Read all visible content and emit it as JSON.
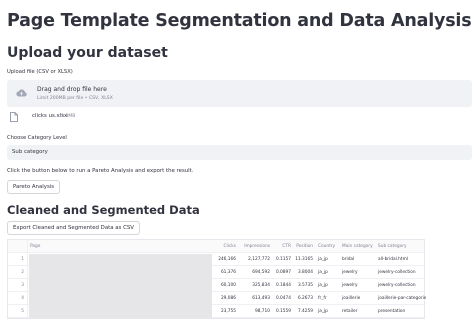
{
  "page": {
    "title": "Page Template Segmentation and Data Analysis"
  },
  "upload": {
    "heading": "Upload your dataset",
    "label": "Upload file (CSV or XLSX)",
    "drop_title": "Drag and drop file here",
    "drop_sub": "Limit 200MB per file • CSV, XLSX",
    "file_name": "clicks us.xlsx",
    "file_size": "1.8MB"
  },
  "category": {
    "label": "Choose Category Level",
    "selected": "Sub category"
  },
  "pareto": {
    "instruction": "Click the button below to run a Pareto Analysis and export the result.",
    "button_label": "Pareto Analysis"
  },
  "cleaned": {
    "heading": "Cleaned and Segmented Data",
    "export_label": "Export Cleaned and Segmented Data as CSV"
  },
  "table": {
    "columns": [
      "Page",
      "Clicks",
      "Impressions",
      "CTR",
      "Position",
      "Country",
      "Main category",
      "Sub category"
    ],
    "rows": [
      {
        "index": "1",
        "clicks": "246,166",
        "impressions": "2,127,772",
        "ctr": "0.1157",
        "position": "11.3165",
        "country": "ja_jp",
        "main": "bridal",
        "sub": "all-bridal.html"
      },
      {
        "index": "2",
        "clicks": "61,376",
        "impressions": "694,592",
        "ctr": "0.0897",
        "position": "3.8004",
        "country": "ja_jp",
        "main": "jewelry",
        "sub": "jewelry-collection"
      },
      {
        "index": "3",
        "clicks": "60,100",
        "impressions": "325,834",
        "ctr": "0.1844",
        "position": "3.5735",
        "country": "ja_jp",
        "main": "jewelry",
        "sub": "jewelry-collection"
      },
      {
        "index": "4",
        "clicks": "29,086",
        "impressions": "613,493",
        "ctr": "0.0474",
        "position": "6.2673",
        "country": "fr_fr",
        "main": "joaillerie",
        "sub": "joaillerie-par-categorie"
      },
      {
        "index": "5",
        "clicks": "23,755",
        "impressions": "98,710",
        "ctr": "0.1559",
        "position": "7.4259",
        "country": "ja_jp",
        "main": "retailer",
        "sub": "presentation"
      }
    ]
  },
  "colors": {
    "widget_bg": "#f0f2f6",
    "text": "#31333f",
    "muted": "#808495",
    "redaction": "#e6e6e8"
  },
  "icons": {
    "upload": "cloud-upload-icon",
    "file": "file-icon"
  }
}
